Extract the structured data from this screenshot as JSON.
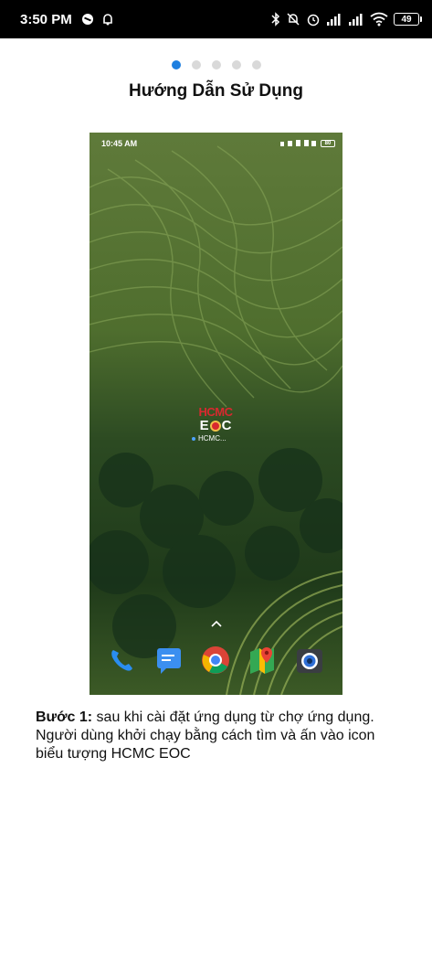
{
  "status_bar": {
    "time": "3:50 PM",
    "battery": "49",
    "icons": [
      "do-not-disturb-icon",
      "alarm-clock-icon",
      "bluetooth-icon",
      "mute-icon",
      "alarm-icon",
      "signal-icon",
      "signal-icon",
      "wifi-icon",
      "battery-icon"
    ]
  },
  "pager": {
    "count": 5,
    "active_index": 0
  },
  "page": {
    "title": "Hướng Dẫn Sử Dụng"
  },
  "screenshot": {
    "status_time": "10:45 AM",
    "battery": "80",
    "app_logo_top": "HCMC",
    "app_logo_bottom_left": "E",
    "app_logo_bottom_right": "C",
    "app_label": "HCMC...",
    "dock_icons": [
      "phone-icon",
      "messages-icon",
      "chrome-icon",
      "maps-icon",
      "camera-icon"
    ]
  },
  "instruction": {
    "step_label": "Bước 1:",
    "text": " sau khi cài đặt ứng dụng từ chợ ứng dụng. Người dùng khởi chạy bằng cách tìm và ấn vào icon biểu tượng HCMC EOC"
  },
  "colors": {
    "accent": "#1e7fe0",
    "logo_red": "#d8292f",
    "dot_inactive": "#d9d9d9"
  }
}
